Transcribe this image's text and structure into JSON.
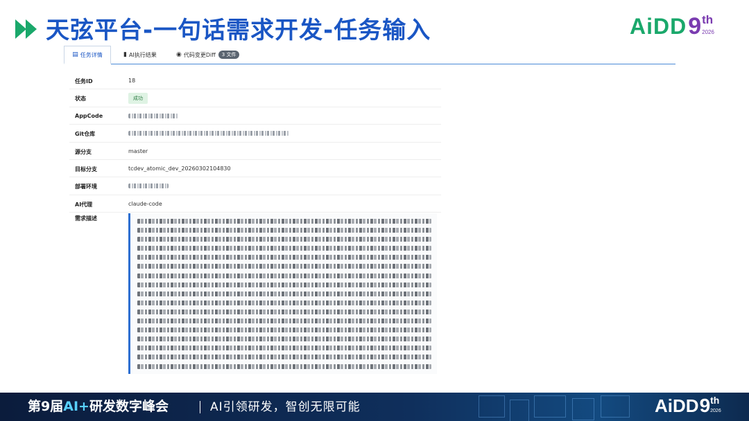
{
  "slide": {
    "title": "天弦平台-一句话需求开发-任务输入",
    "logo": {
      "main": "AiDD",
      "nine": "9",
      "sup": "th",
      "year": "2026"
    }
  },
  "tabs": [
    {
      "label": "任务详情",
      "icon": "document-icon",
      "active": true
    },
    {
      "label": "AI执行结果",
      "icon": "bookmark-icon",
      "active": false
    },
    {
      "label": "代码变更Diff",
      "icon": "eye-icon",
      "active": false,
      "badge": "3 文件"
    }
  ],
  "details": {
    "task_id": {
      "label": "任务ID",
      "value": "18"
    },
    "status": {
      "label": "状态",
      "value": "成功"
    },
    "app_code": {
      "label": "AppCode"
    },
    "git_repo": {
      "label": "Git仓库"
    },
    "source_branch": {
      "label": "源分支",
      "value": "master"
    },
    "target_branch": {
      "label": "目标分支",
      "value": "tcdev_atomic_dev_20260302104830"
    },
    "deploy_env": {
      "label": "部署环境"
    },
    "ai_agent": {
      "label": "AI代理",
      "value": "claude-code"
    },
    "requirement": {
      "label": "需求描述"
    }
  },
  "footer": {
    "event_prefix": "第9届",
    "event_accent": "AI+",
    "event_suffix": "研发数字峰会",
    "slogan": "AI引领研发，智创无限可能",
    "logo": {
      "main": "AiDD",
      "nine": "9",
      "sup": "th",
      "year": "2026"
    }
  },
  "colors": {
    "title_blue": "#1a56c4",
    "arrow_green": "#1aa86b",
    "logo_green": "#1aa86b",
    "logo_purple": "#7a3bb0",
    "status_green_bg": "#dff3e4",
    "status_green_text": "#2e7d45",
    "tab_underline": "#4a8ad6",
    "footer_bg": "#0f2f5c"
  }
}
